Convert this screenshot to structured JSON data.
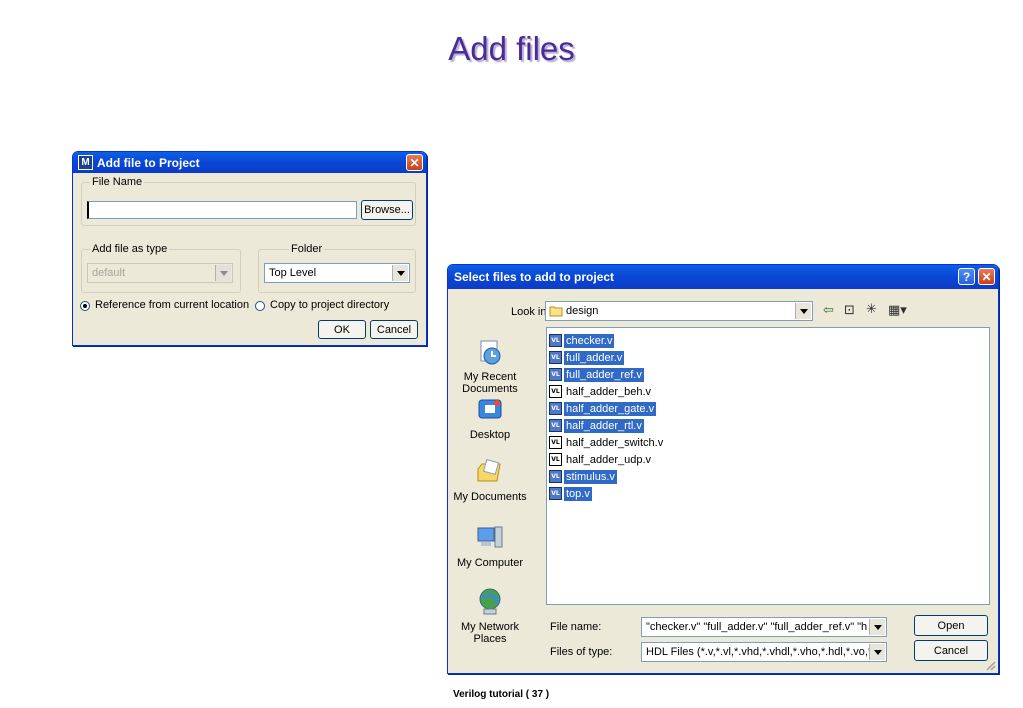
{
  "slide": {
    "title": "Add files",
    "footer": "Verilog tutorial  ( 37 )"
  },
  "add_file_dialog": {
    "title": "Add file to Project",
    "title_icon_glyph": "M",
    "file_name_group": "File Name",
    "file_name_value": "",
    "browse_label": "Browse...",
    "type_group": "Add file as type",
    "type_value": "default",
    "folder_group": "Folder",
    "folder_value": "Top Level",
    "radio_reference": "Reference from current location",
    "radio_copy": "Copy to project directory",
    "ok_label": "OK",
    "cancel_label": "Cancel",
    "close_glyph": "✕"
  },
  "select_files_dialog": {
    "title": "Select files to add to project",
    "help_glyph": "?",
    "close_glyph": "✕",
    "look_in_label": "Look in:",
    "look_in_value": "design",
    "places": [
      {
        "label": "My Recent Documents",
        "icon": "recent-documents-icon"
      },
      {
        "label": "Desktop",
        "icon": "desktop-icon"
      },
      {
        "label": "My Documents",
        "icon": "my-documents-icon"
      },
      {
        "label": "My Computer",
        "icon": "my-computer-icon"
      },
      {
        "label": "My Network Places",
        "icon": "network-places-icon"
      }
    ],
    "files": [
      {
        "name": "checker.v",
        "selected": true
      },
      {
        "name": "full_adder.v",
        "selected": true
      },
      {
        "name": "full_adder_ref.v",
        "selected": true
      },
      {
        "name": "half_adder_beh.v",
        "selected": false
      },
      {
        "name": "half_adder_gate.v",
        "selected": true
      },
      {
        "name": "half_adder_rtl.v",
        "selected": true
      },
      {
        "name": "half_adder_switch.v",
        "selected": false
      },
      {
        "name": "half_adder_udp.v",
        "selected": false
      },
      {
        "name": "stimulus.v",
        "selected": true
      },
      {
        "name": "top.v",
        "selected": true
      }
    ],
    "file_icon_text": "VL",
    "file_name_label": "File name:",
    "file_name_value": "\"checker.v\" \"full_adder.v\" \"full_adder_ref.v\" \"h",
    "files_of_type_label": "Files of type:",
    "files_of_type_value": "HDL Files (*.v,*.vl,*.vhd,*.vhdl,*.vho,*.hdl,*.vo,*",
    "open_label": "Open",
    "cancel_label": "Cancel"
  }
}
